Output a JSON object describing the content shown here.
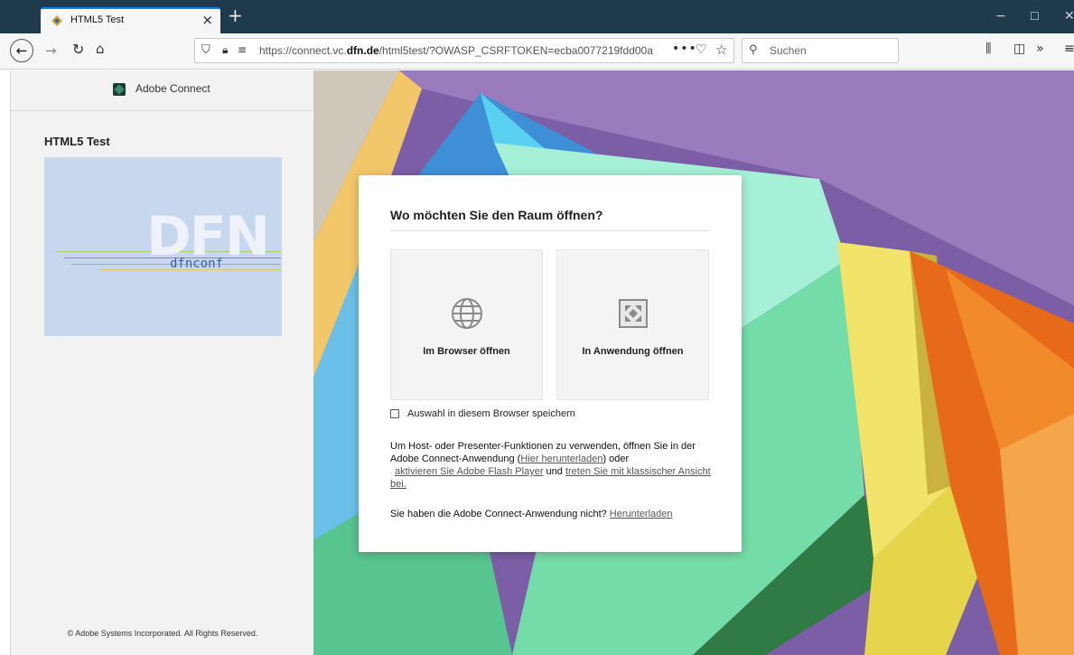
{
  "browser": {
    "tab_title": "HTML5 Test",
    "new_tab_label": "+",
    "url_prefix": "https://connect.vc.",
    "url_domain": "dfn.de",
    "url_suffix": "/html5test/?OWASP_CSRFTOKEN=ecba0077219fdd00a",
    "url_more": "•••",
    "search_placeholder": "Suchen",
    "colors": {
      "titlebar": "#1f3a4c",
      "toolbar": "#f5f6f7",
      "tab_accent": "#0a84ff"
    }
  },
  "sidebar": {
    "brand": "Adobe Connect",
    "room_title": "HTML5 Test",
    "thumbnail_big": "DFN",
    "thumbnail_sub": "dfnconf",
    "copyright": "© Adobe Systems Incorporated. All Rights Reserved."
  },
  "dialog": {
    "title": "Wo möchten Sie den Raum öffnen?",
    "options": [
      {
        "label": "Im Browser öffnen",
        "icon": "globe-icon"
      },
      {
        "label": "In Anwendung öffnen",
        "icon": "adobe-connect-app-icon"
      }
    ],
    "remember": {
      "label": "Auswahl in diesem Browser speichern",
      "checked": false
    },
    "info": {
      "part1": "Um Host- oder Presenter-Funktionen zu verwenden, öffnen Sie in der Adobe Connect-Anwendung (",
      "link_download_here": "Hier herunterladen",
      "part2": ") oder",
      "link_flash": "aktivieren Sie Adobe Flash Player",
      "part3": " und ",
      "link_classic": "treten Sie mit klassischer Ansicht bei."
    },
    "noapp": {
      "text": "Sie haben die Adobe Connect-Anwendung nicht? ",
      "link": "Herunterladen"
    }
  }
}
